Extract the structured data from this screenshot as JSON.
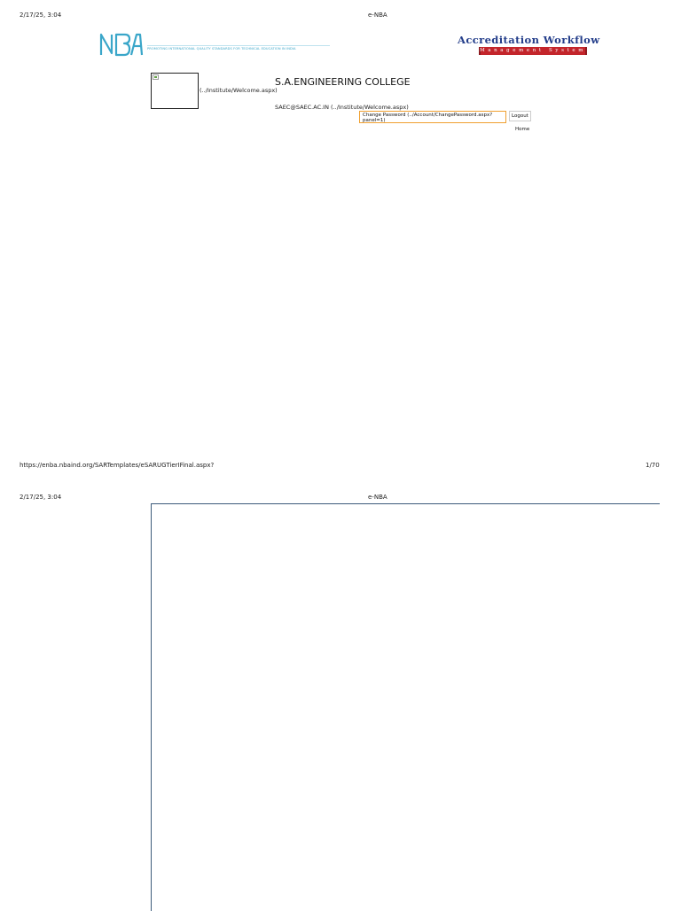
{
  "print_header": {
    "datetime": "2/17/25, 3:04",
    "title": "e-NBA"
  },
  "print_footer": {
    "url": "https://enba.nbaind.org/SARTemplates/eSARUGTierIFinal.aspx?",
    "page": "1/70"
  },
  "page2_header": {
    "datetime": "2/17/25, 3:04",
    "title": "e-NBA"
  },
  "nba_logo": {
    "text": "NBA",
    "tagline": "PROMOTING INTERNATIONAL QUALITY STANDARDS FOR TECHNICAL EDUCATION IN INDIA",
    "color": "#3aa6c9"
  },
  "aw_logo": {
    "title": "Accreditation Workflow",
    "subtitle": "Management System",
    "title_color": "#233d8a",
    "bar_color": "#c3252b"
  },
  "institute": {
    "image_link": "(../Institute/Welcome.aspx)",
    "name": "S.A.ENGINEERING COLLEGE",
    "email_link": "SAEC@SAEC.AC.IN (../Institute/Welcome.aspx)"
  },
  "account": {
    "change_password": "Change Password (../Account/ChangePassword.aspx?panel=1)",
    "logout": "Logout",
    "home": "Home"
  }
}
